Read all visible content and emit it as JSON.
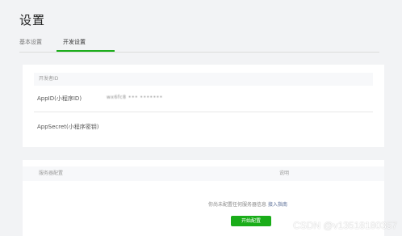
{
  "header": {
    "title": "设置"
  },
  "tabs": [
    {
      "label": "基本设置"
    },
    {
      "label": "开发设置",
      "active": true
    }
  ],
  "dev_settings": {
    "section_title": "开发者ID",
    "appid_label": "AppID(小程序ID)",
    "appid_value": "wx6fc8 ••• •••••••",
    "appsecret_label": "AppSecret(小程序密钥)"
  },
  "server": {
    "col_config": "服务器配置",
    "col_desc": "说明",
    "empty_hint": "你尚未配置任何服务器信息",
    "guide_link": "接入指南",
    "start_button": "开始配置"
  },
  "watermark": "CSDN @v13518180357",
  "colors": {
    "accent": "#1aad19",
    "link": "#576b95",
    "background": "#f2f3f5"
  }
}
